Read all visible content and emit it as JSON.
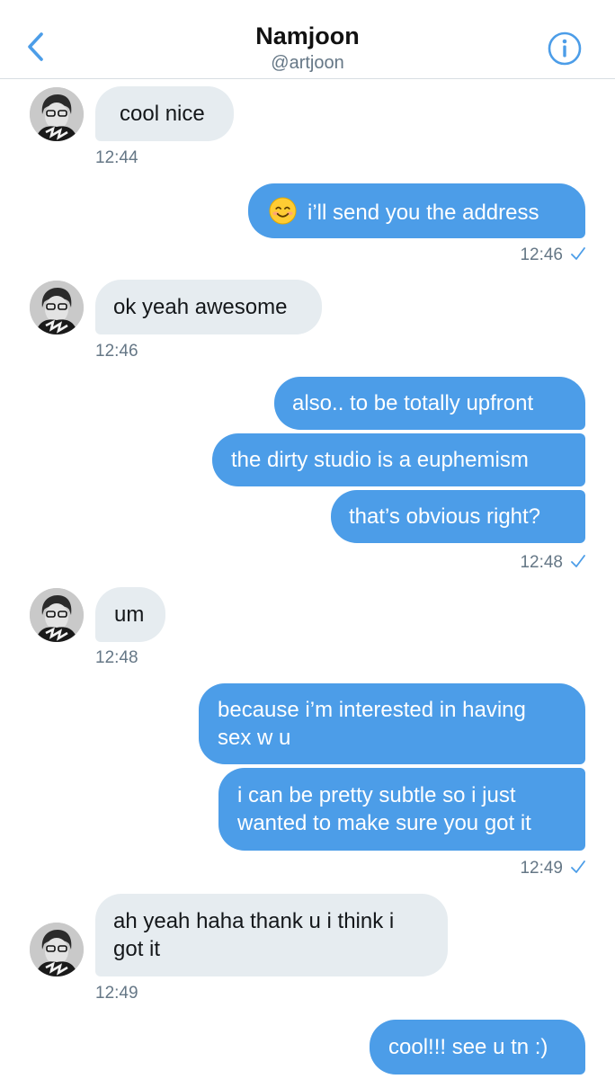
{
  "header": {
    "name": "Namjoon",
    "handle": "@artjoon"
  },
  "colors": {
    "accent": "#4c9de8",
    "incoming_bubble": "#e6ecf0",
    "timestamp": "#657786"
  },
  "icons": {
    "back": "chevron-left-icon",
    "info": "info-circle-icon",
    "read": "checkmark-icon",
    "emoji": "smiling-face-emoji"
  },
  "messages": [
    {
      "direction": "in",
      "text": "cool nice",
      "time": "12:44"
    },
    {
      "direction": "out",
      "text": "i’ll send you the address",
      "emoji": "😊",
      "time": "12:46",
      "read": true
    },
    {
      "direction": "in",
      "text": "ok yeah awesome",
      "time": "12:46"
    },
    {
      "direction": "out",
      "text": "also.. to be totally upfront"
    },
    {
      "direction": "out",
      "text": "the dirty studio is a euphemism"
    },
    {
      "direction": "out",
      "text": "that’s obvious right?",
      "time": "12:48",
      "read": true
    },
    {
      "direction": "in",
      "text": "um",
      "time": "12:48"
    },
    {
      "direction": "out",
      "lines": [
        "because i’m interested in having",
        "sex w u"
      ]
    },
    {
      "direction": "out",
      "lines": [
        "i can be pretty subtle so i just",
        "wanted to make sure you got it"
      ],
      "time": "12:49",
      "read": true
    },
    {
      "direction": "in",
      "lines": [
        "ah yeah haha thank u i think i",
        "got it"
      ],
      "time": "12:49"
    },
    {
      "direction": "out",
      "text": "cool!!! see u tn :)"
    }
  ]
}
